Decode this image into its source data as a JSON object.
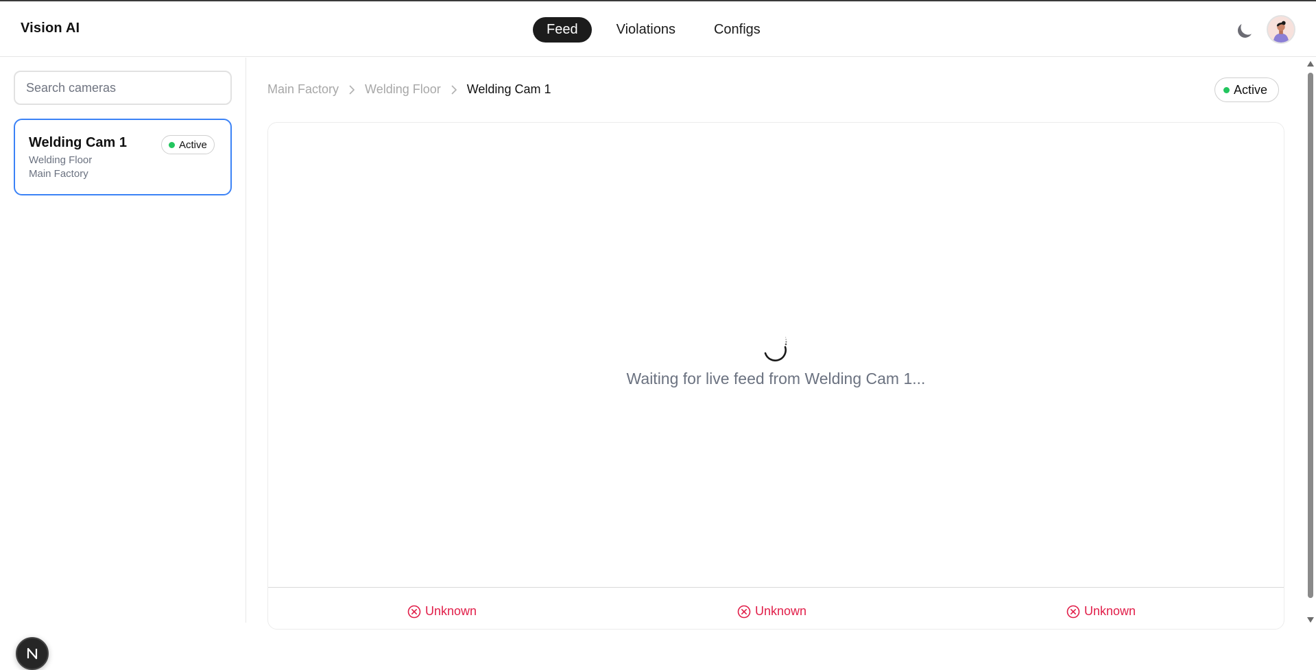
{
  "app": {
    "brand": "Vision AI"
  },
  "nav": {
    "items": [
      {
        "label": "Feed",
        "active": true
      },
      {
        "label": "Violations",
        "active": false
      },
      {
        "label": "Configs",
        "active": false
      }
    ]
  },
  "header": {
    "theme_icon": "moon-icon",
    "avatar_icon": "user-avatar"
  },
  "sidebar": {
    "search_placeholder": "Search cameras",
    "cameras": [
      {
        "name": "Welding Cam 1",
        "floor": "Welding Floor",
        "site": "Main Factory",
        "status": "Active",
        "selected": true
      }
    ],
    "floating_button_icon": "next-logo-icon"
  },
  "main": {
    "breadcrumb": [
      "Main Factory",
      "Welding Floor",
      "Welding Cam 1"
    ],
    "status": "Active",
    "feed": {
      "waiting_text": "Waiting for live feed from Welding Cam 1...",
      "indicators": [
        {
          "label": "Unknown",
          "icon": "x-circle-icon"
        },
        {
          "label": "Unknown",
          "icon": "x-circle-icon"
        },
        {
          "label": "Unknown",
          "icon": "x-circle-icon"
        }
      ]
    }
  },
  "colors": {
    "accent": "#3b82f6",
    "active_dot": "#22c55e",
    "error": "#e11d48",
    "nav_active_bg": "#1c1c1c"
  }
}
